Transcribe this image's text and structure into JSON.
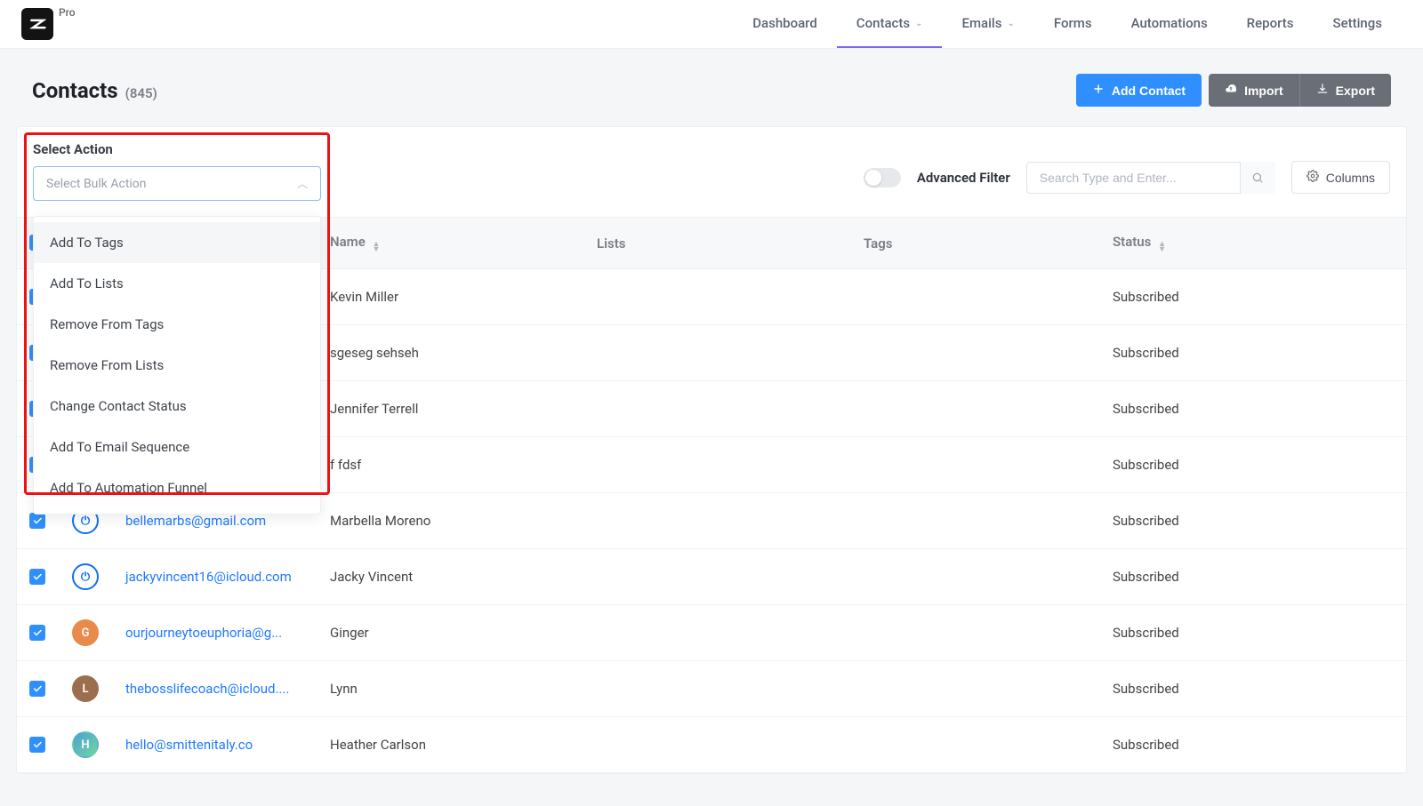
{
  "topnav": {
    "plan": "Pro",
    "items": [
      {
        "label": "Dashboard",
        "hasChevron": false,
        "active": false
      },
      {
        "label": "Contacts",
        "hasChevron": true,
        "active": true
      },
      {
        "label": "Emails",
        "hasChevron": true,
        "active": false
      },
      {
        "label": "Forms",
        "hasChevron": false,
        "active": false
      },
      {
        "label": "Automations",
        "hasChevron": false,
        "active": false
      },
      {
        "label": "Reports",
        "hasChevron": false,
        "active": false
      },
      {
        "label": "Settings",
        "hasChevron": false,
        "active": false
      }
    ]
  },
  "header": {
    "title": "Contacts",
    "count": "(845)",
    "addContact": "Add Contact",
    "import": "Import",
    "export": "Export"
  },
  "toolbar": {
    "actionLabel": "Select Action",
    "selectPlaceholder": "Select Bulk Action",
    "options": [
      "Add To Tags",
      "Add To Lists",
      "Remove From Tags",
      "Remove From Lists",
      "Change Contact Status",
      "Add To Email Sequence",
      "Add To Automation Funnel"
    ],
    "advancedFilter": "Advanced Filter",
    "searchPlaceholder": "Search Type and Enter...",
    "columnsBtn": "Columns"
  },
  "table": {
    "headers": {
      "name": "Name",
      "lists": "Lists",
      "tags": "Tags",
      "status": "Status"
    },
    "rows": [
      {
        "checked": true,
        "avatarClass": "ring-blue",
        "avatarText": "⏻",
        "email": "…",
        "name": "Kevin Miller",
        "lists": "",
        "tags": "",
        "status": "Subscribed"
      },
      {
        "checked": true,
        "avatarClass": "ring-blue",
        "avatarText": "⏻",
        "email": "…",
        "name": "sgeseg sehseh",
        "lists": "",
        "tags": "",
        "status": "Subscribed"
      },
      {
        "checked": true,
        "avatarClass": "ring-blue",
        "avatarText": "⏻",
        "email": "…",
        "name": "Jennifer Terrell",
        "lists": "",
        "tags": "",
        "status": "Subscribed"
      },
      {
        "checked": true,
        "avatarClass": "ring-blue",
        "avatarText": "⏻",
        "email": "…",
        "name": "f fdsf",
        "lists": "",
        "tags": "",
        "status": "Subscribed"
      },
      {
        "checked": true,
        "avatarClass": "ring-blue",
        "avatarText": "⏻",
        "email": "bellemarbs@gmail.com",
        "name": "Marbella Moreno",
        "lists": "",
        "tags": "",
        "status": "Subscribed"
      },
      {
        "checked": true,
        "avatarClass": "ring-blue",
        "avatarText": "⏻",
        "email": "jackyvincent16@icloud.com",
        "name": "Jacky Vincent",
        "lists": "",
        "tags": "",
        "status": "Subscribed"
      },
      {
        "checked": true,
        "avatarClass": "bg-orange",
        "avatarText": "G",
        "email": "ourjourneytoeuphoria@g...",
        "name": "Ginger",
        "lists": "",
        "tags": "",
        "status": "Subscribed"
      },
      {
        "checked": true,
        "avatarClass": "bg-brown",
        "avatarText": "L",
        "email": "thebosslifecoach@icloud....",
        "name": "Lynn",
        "lists": "",
        "tags": "",
        "status": "Subscribed"
      },
      {
        "checked": true,
        "avatarClass": "bg-teal",
        "avatarText": "H",
        "email": "hello@smittenitaly.co",
        "name": "Heather Carlson",
        "lists": "",
        "tags": "",
        "status": "Subscribed"
      }
    ]
  }
}
